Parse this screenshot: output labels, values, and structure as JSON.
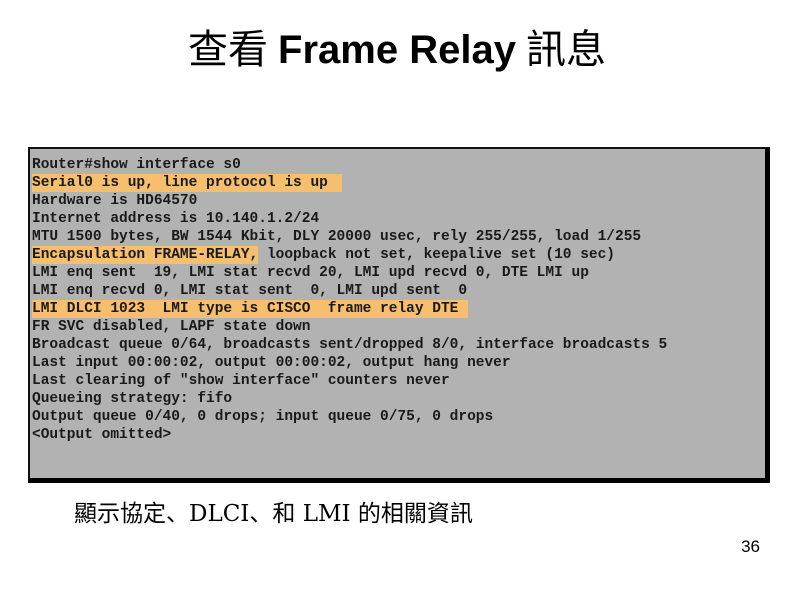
{
  "slide": {
    "title": {
      "prefix_cjk": "查看",
      "latin": "Frame Relay",
      "suffix_cjk": "訊息"
    },
    "terminal": {
      "background_color": "#b2b2b2",
      "highlight_color": "#f6bf6e",
      "lines": [
        {
          "highlight": "",
          "rest": "Router#show interface s0"
        },
        {
          "highlight": "Serial0 is up, line protocol is up",
          "rest": ""
        },
        {
          "highlight": "",
          "rest": "Hardware is HD64570"
        },
        {
          "highlight": "",
          "rest": "Internet address is 10.140.1.2/24"
        },
        {
          "highlight": "",
          "rest": "MTU 1500 bytes, BW 1544 Kbit, DLY 20000 usec, rely 255/255, load 1/255"
        },
        {
          "highlight": "Encapsulation FRAME-RELAY,",
          "rest": " loopback not set, keepalive set (10 sec)"
        },
        {
          "highlight": "",
          "rest": "LMI enq sent  19, LMI stat recvd 20, LMI upd recvd 0, DTE LMI up"
        },
        {
          "highlight": "",
          "rest": "LMI enq recvd 0, LMI stat sent  0, LMI upd sent  0"
        },
        {
          "highlight": "LMI DLCI 1023  LMI type is CISCO  frame relay DTE",
          "rest": ""
        },
        {
          "highlight": "",
          "rest": "FR SVC disabled, LAPF state down"
        },
        {
          "highlight": "",
          "rest": "Broadcast queue 0/64, broadcasts sent/dropped 8/0, interface broadcasts 5"
        },
        {
          "highlight": "",
          "rest": "Last input 00:00:02, output 00:00:02, output hang never"
        },
        {
          "highlight": "",
          "rest": "Last clearing of \"show interface\" counters never"
        },
        {
          "highlight": "",
          "rest": "Queueing strategy: fifo"
        },
        {
          "highlight": "",
          "rest": "Output queue 0/40, 0 drops; input queue 0/75, 0 drops"
        },
        {
          "highlight": "",
          "rest": "<Output omitted>"
        }
      ]
    },
    "caption": "顯示協定、DLCI、和 LMI 的相關資訊",
    "page_number": "36"
  }
}
